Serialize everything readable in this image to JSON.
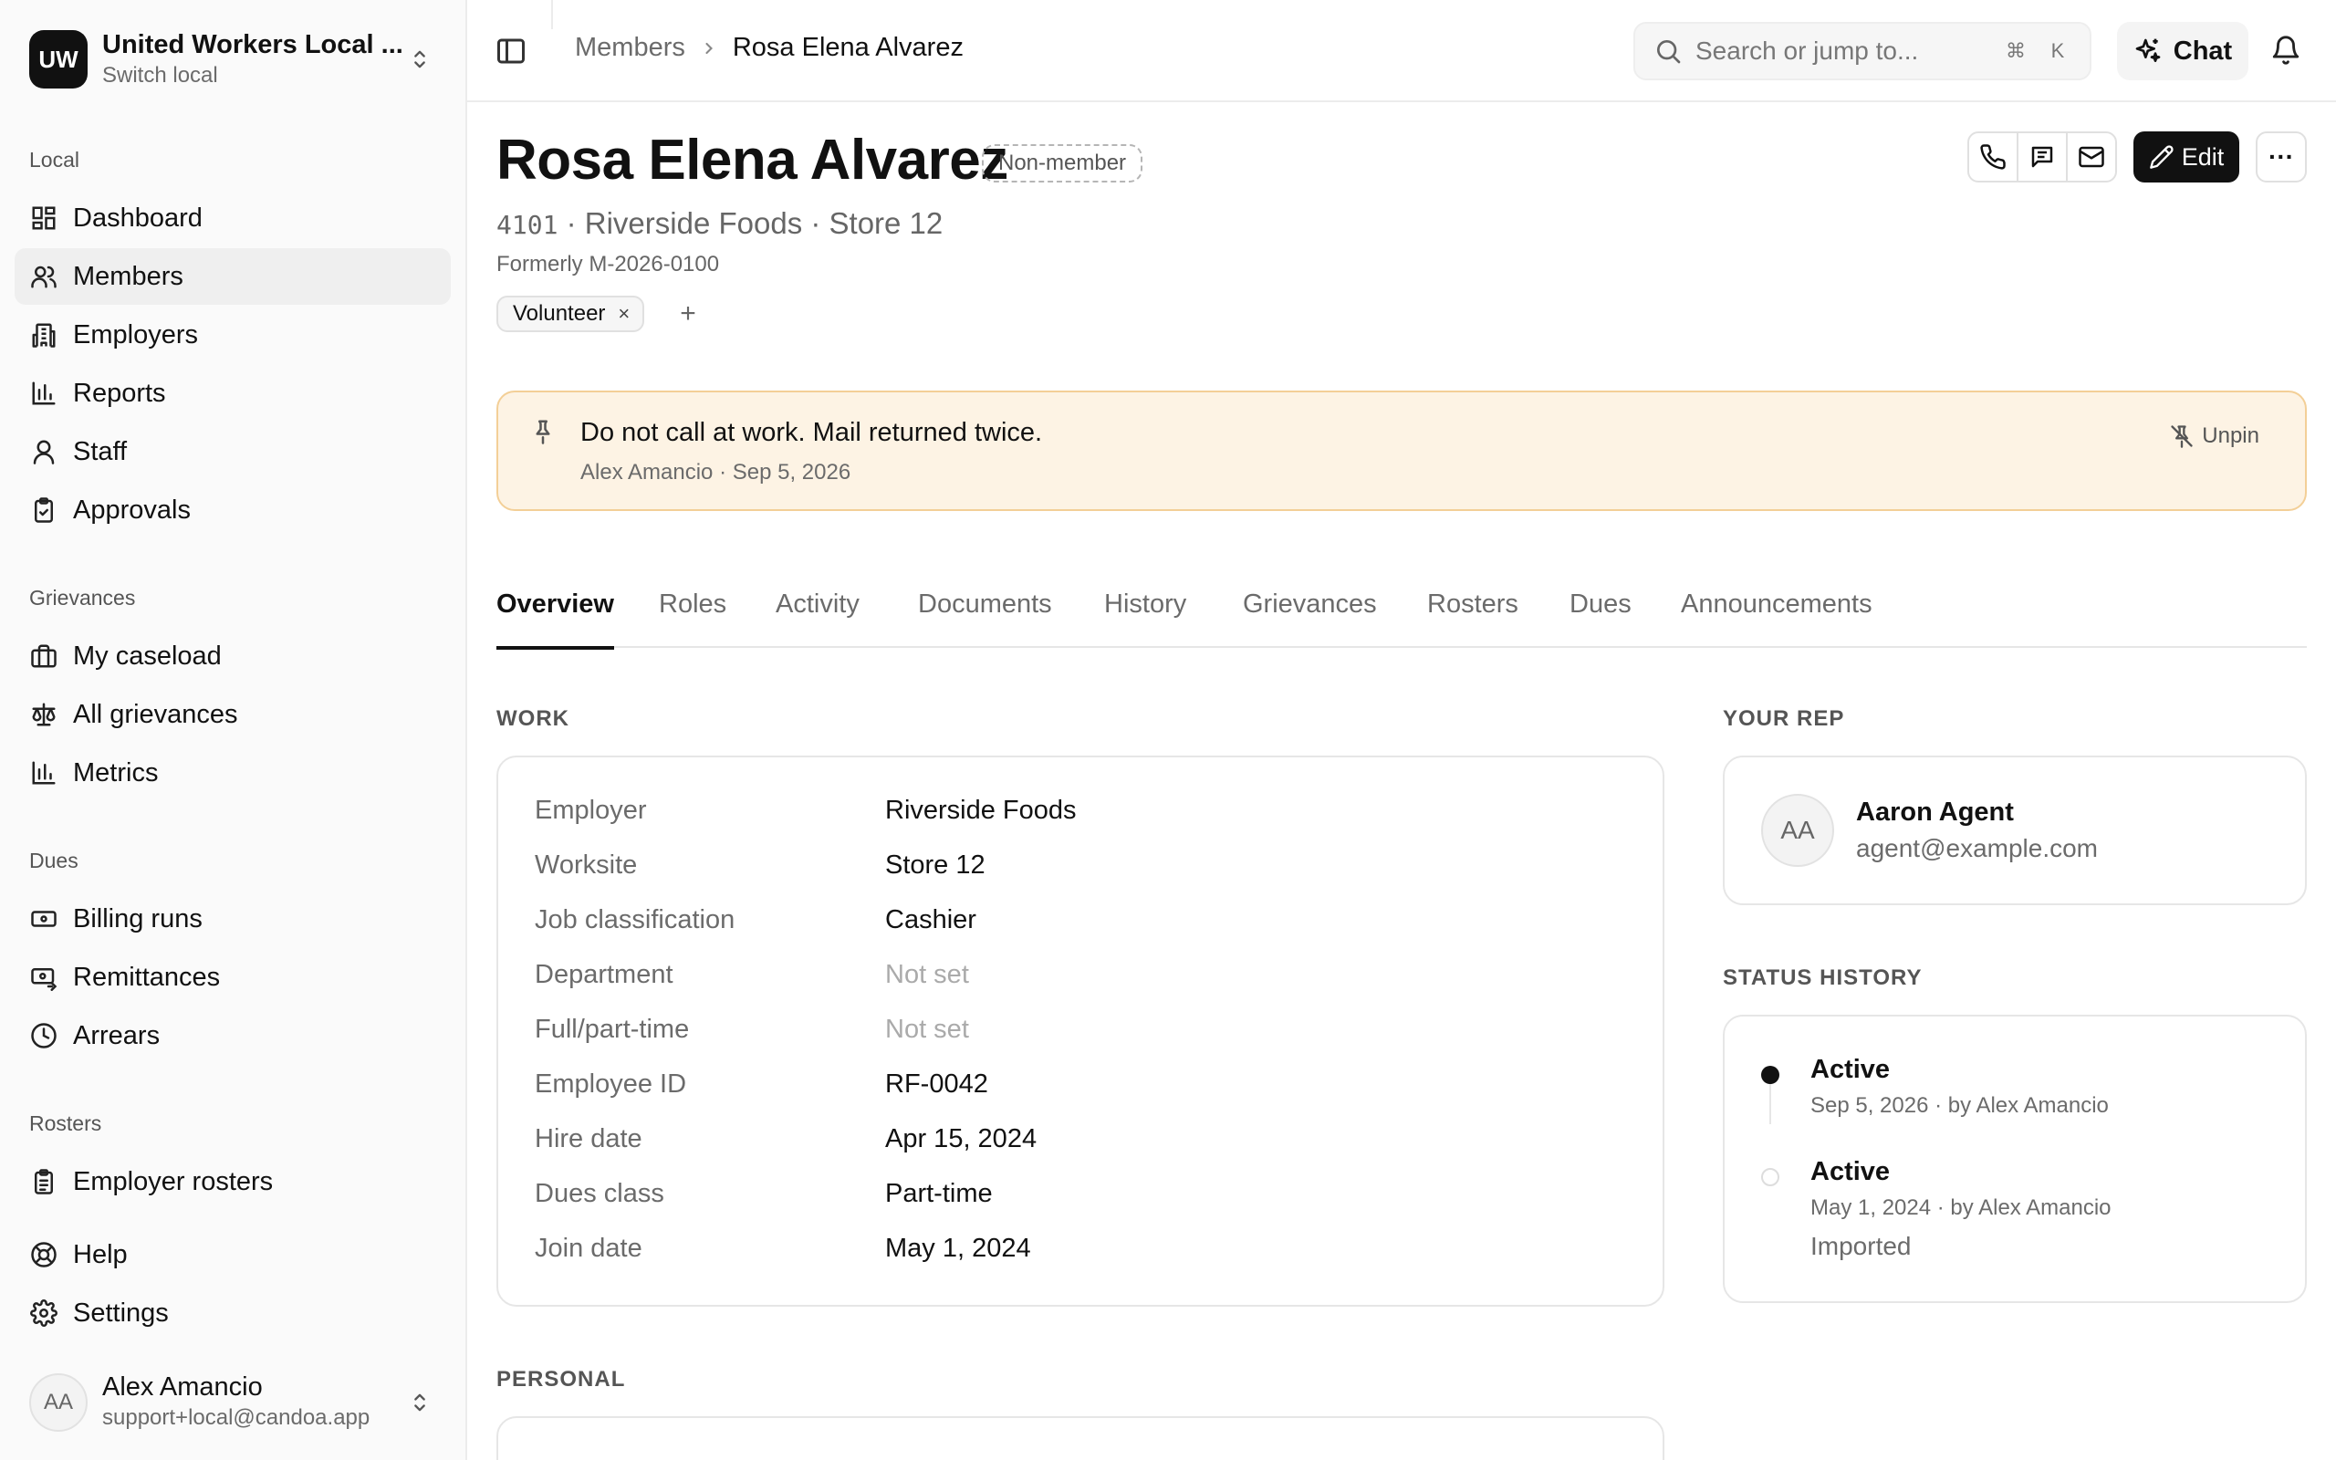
{
  "sidebar": {
    "org": {
      "initials": "UW",
      "name": "United Workers Local ...",
      "sub": "Switch local"
    },
    "sections": {
      "local": "Local",
      "grievances": "Grievances",
      "dues": "Dues",
      "rosters": "Rosters"
    },
    "items": {
      "dashboard": "Dashboard",
      "members": "Members",
      "employers": "Employers",
      "reports": "Reports",
      "staff": "Staff",
      "approvals": "Approvals",
      "my_caseload": "My caseload",
      "all_grievances": "All grievances",
      "metrics": "Metrics",
      "billing_runs": "Billing runs",
      "remittances": "Remittances",
      "arrears": "Arrears",
      "employer_rosters": "Employer rosters",
      "help": "Help",
      "settings": "Settings"
    },
    "user": {
      "initials": "AA",
      "name": "Alex Amancio",
      "email": "support+local@candoa.app"
    }
  },
  "topbar": {
    "breadcrumb": [
      "Members",
      "Rosa Elena Alvarez"
    ],
    "search_placeholder": "Search or jump to...",
    "kbd": [
      "⌘",
      "K"
    ],
    "chat_label": "Chat"
  },
  "profile": {
    "name": "Rosa Elena Alvarez",
    "badge": "Non-member",
    "number": "4101",
    "employer_line": " · Riverside Foods · Store 12",
    "formerly": "Formerly M-2026-0100",
    "tag": "Volunteer",
    "tag_remove": "×",
    "tag_add": "+",
    "edit_label": "Edit",
    "more": "···"
  },
  "note": {
    "text": "Do not call at work. Mail returned twice.",
    "meta": "Alex Amancio · Sep 5, 2026",
    "unpin": "Unpin"
  },
  "tabs": [
    "Overview",
    "Roles",
    "Activity",
    "Documents",
    "History",
    "Grievances",
    "Rosters",
    "Dues",
    "Announcements"
  ],
  "work": {
    "heading": "WORK",
    "rows": [
      {
        "k": "Employer",
        "v": "Riverside Foods"
      },
      {
        "k": "Worksite",
        "v": "Store 12"
      },
      {
        "k": "Job classification",
        "v": "Cashier"
      },
      {
        "k": "Department",
        "v": "Not set"
      },
      {
        "k": "Full/part-time",
        "v": "Not set"
      },
      {
        "k": "Employee ID",
        "v": "RF-0042"
      },
      {
        "k": "Hire date",
        "v": "Apr 15, 2024"
      },
      {
        "k": "Dues class",
        "v": "Part-time"
      },
      {
        "k": "Join date",
        "v": "May 1, 2024"
      }
    ]
  },
  "rep": {
    "heading": "YOUR REP",
    "initials": "AA",
    "name": "Aaron Agent",
    "email": "agent@example.com"
  },
  "status_history": {
    "heading": "STATUS HISTORY",
    "entries": [
      {
        "status": "Active",
        "meta": "Sep 5, 2026 · by Alex Amancio"
      },
      {
        "status": "Active",
        "meta": "May 1, 2024 · by Alex Amancio",
        "note": "Imported"
      }
    ]
  },
  "personal": {
    "heading": "PERSONAL"
  }
}
